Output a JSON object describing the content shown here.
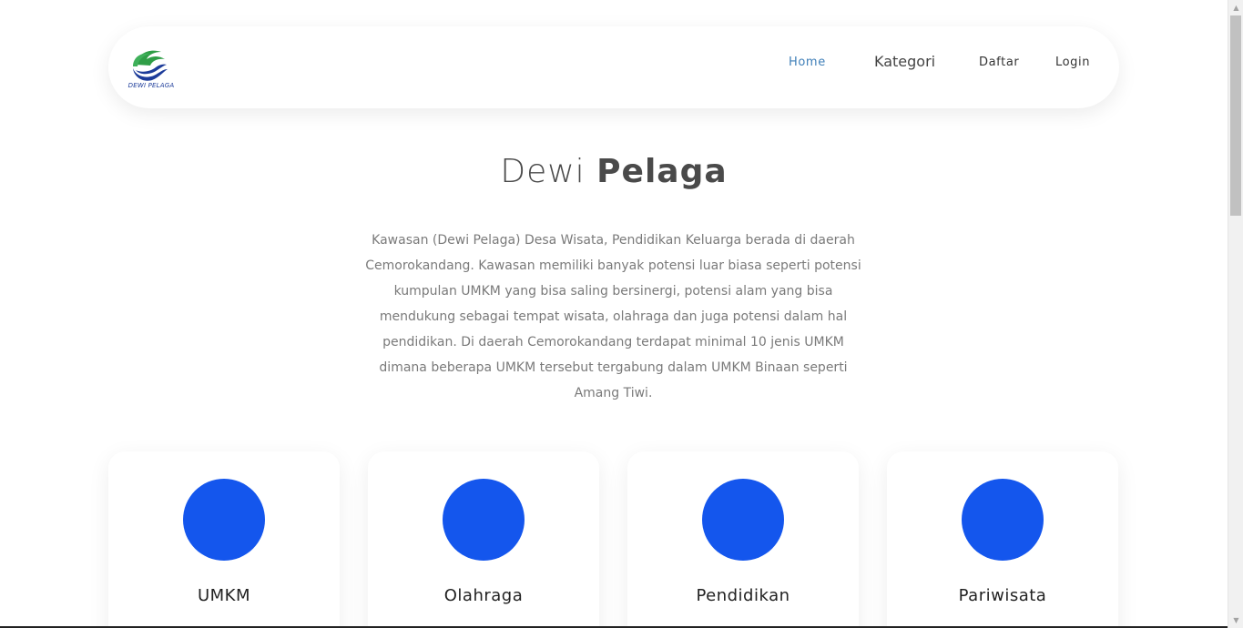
{
  "header": {
    "logo_text": "DEWI PELAGA",
    "nav": {
      "home": "Home",
      "kategori": "Kategori",
      "daftar": "Daftar",
      "login": "Login"
    }
  },
  "hero": {
    "title_light": "Dewi",
    "title_bold": "Pelaga",
    "description": "Kawasan (Dewi Pelaga) Desa Wisata, Pendidikan Keluarga berada di daerah Cemorokandang. Kawasan memiliki banyak potensi luar biasa seperti potensi kumpulan UMKM yang bisa saling bersinergi, potensi alam yang bisa mendukung sebagai tempat wisata, olahraga dan juga potensi dalam hal pendidikan. Di daerah Cemorokandang terdapat minimal 10 jenis UMKM dimana beberapa UMKM tersebut tergabung dalam UMKM Binaan seperti Amang Tiwi."
  },
  "categories": [
    {
      "label": "UMKM"
    },
    {
      "label": "Olahraga"
    },
    {
      "label": "Pendidikan"
    },
    {
      "label": "Pariwisata"
    }
  ],
  "colors": {
    "accent": "#1456ed",
    "nav_active": "#3f7fb8",
    "logo_green": "#2f9e46",
    "logo_blue": "#1d3c9a"
  }
}
